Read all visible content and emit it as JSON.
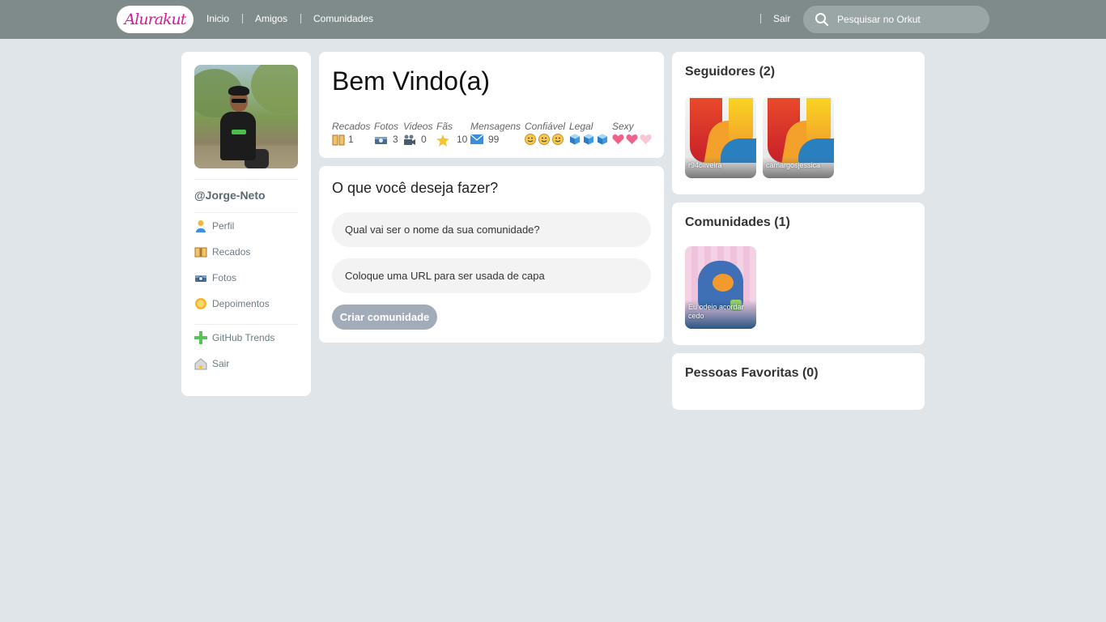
{
  "header": {
    "logo": "Alurakut",
    "nav": [
      "Inicio",
      "Amigos",
      "Comunidades"
    ],
    "logout": "Sair",
    "search_placeholder": "Pesquisar no Orkut"
  },
  "sidebar": {
    "username": "@Jorge-Neto",
    "menu": [
      {
        "label": "Perfil",
        "icon": "user-icon"
      },
      {
        "label": "Recados",
        "icon": "book-icon"
      },
      {
        "label": "Fotos",
        "icon": "camera-icon"
      },
      {
        "label": "Depoimentos",
        "icon": "sun-icon"
      },
      {
        "label": "GitHub Trends",
        "icon": "plus-icon"
      },
      {
        "label": "Sair",
        "icon": "logout-icon"
      }
    ]
  },
  "welcome": {
    "title": "Bem Vindo(a)",
    "stats": {
      "recados": {
        "label": "Recados",
        "value": "1"
      },
      "fotos": {
        "label": "Fotos",
        "value": "3"
      },
      "videos": {
        "label": "Videos",
        "value": "0"
      },
      "fas": {
        "label": "Fãs",
        "value": "10"
      },
      "mensagens": {
        "label": "Mensagens",
        "value": "99"
      },
      "confiavel": {
        "label": "Confiável",
        "level": 3
      },
      "legal": {
        "label": "Legal",
        "level": 3
      },
      "sexy": {
        "label": "Sexy",
        "level": 2,
        "max": 3
      }
    }
  },
  "form": {
    "heading": "O que você deseja fazer?",
    "name_placeholder": "Qual vai ser o nome da sua comunidade?",
    "cover_placeholder": "Coloque uma URL para ser usada de capa",
    "submit_label": "Criar comunidade"
  },
  "followers": {
    "title": "Seguidores (2)",
    "items": [
      "r94oliveira",
      "camargosjessica"
    ]
  },
  "communities": {
    "title": "Comunidades (1)",
    "items": [
      "Eu odeio acordar cedo"
    ]
  },
  "favorites": {
    "title": "Pessoas Favoritas (0)"
  },
  "colors": {
    "topbar": "#7f8b8b",
    "background": "#dfe5e8",
    "logo_pink": "#d81d99",
    "button": "#a2acb9"
  }
}
